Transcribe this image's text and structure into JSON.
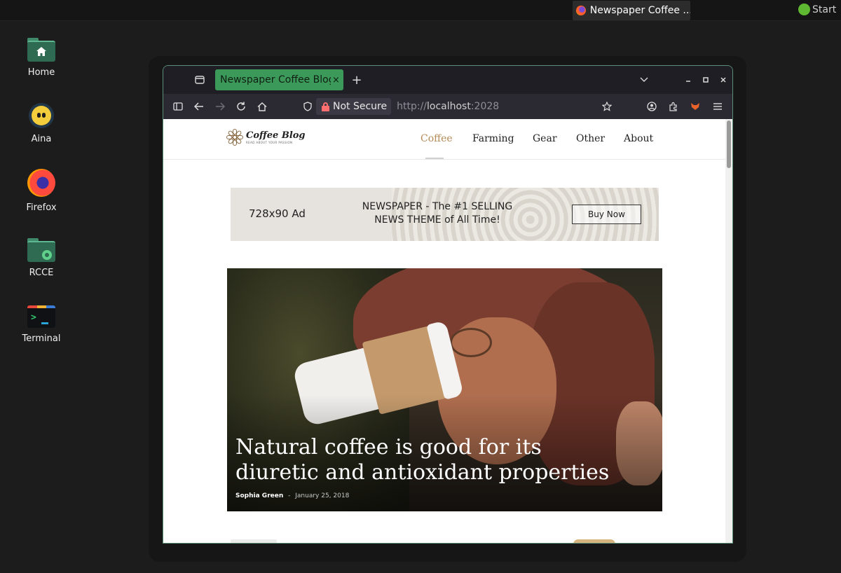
{
  "panel": {
    "taskbar_title": "Newspaper Coffee ...",
    "start_label": "Start"
  },
  "desktop": {
    "icons": [
      {
        "label": "Home",
        "icon": "home-folder-icon"
      },
      {
        "label": "Aina",
        "icon": "aina-icon"
      },
      {
        "label": "Firefox",
        "icon": "firefox-icon"
      },
      {
        "label": "RCCE",
        "icon": "rcce-folder-icon"
      },
      {
        "label": "Terminal",
        "icon": "terminal-icon"
      }
    ]
  },
  "browser": {
    "tab_title": "Newspaper Coffee Blog",
    "tab_close": "×",
    "new_tab": "+",
    "security_label": "Not Secure",
    "url_scheme": "http://",
    "url_host": "localhost",
    "url_port": ":2028"
  },
  "site": {
    "logo_name": "Coffee Blog",
    "logo_tagline": "READ ABOUT YOUR PASSION",
    "nav": [
      "Coffee",
      "Farming",
      "Gear",
      "Other",
      "About"
    ],
    "active_nav": "Coffee",
    "ad": {
      "size": "728x90 Ad",
      "pitch": "NEWSPAPER - The #1 SELLING\nNEWS THEME of All Time!",
      "button": "Buy Now"
    },
    "featured": {
      "title": "Natural coffee is good for its diuretic and antioxidant properties",
      "author": "Sophia Green",
      "separator": "-",
      "date": "January 25, 2018"
    }
  },
  "colors": {
    "tab_accent": "#3b9a5a",
    "window_border": "#5b8f78",
    "nav_active": "#b48a55",
    "start_dot": "#5fb832"
  }
}
